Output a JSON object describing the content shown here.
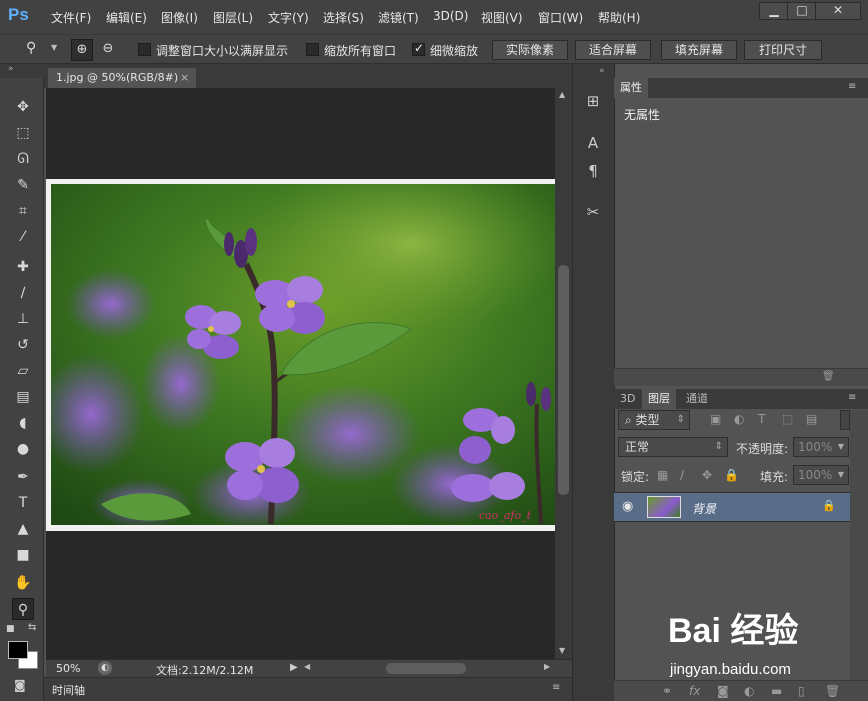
{
  "app": {
    "logo": "Ps"
  },
  "menu": [
    "文件(F)",
    "编辑(E)",
    "图像(I)",
    "图层(L)",
    "文字(Y)",
    "选择(S)",
    "滤镜(T)",
    "3D(D)",
    "视图(V)",
    "窗口(W)",
    "帮助(H)"
  ],
  "window_controls": [
    "▁",
    "□",
    "✕"
  ],
  "options": {
    "cb_resize_windows": "调整窗口大小以满屏显示",
    "cb_zoom_all": "缩放所有窗口",
    "cb_scrubby": "细微缩放",
    "scrubby_checked": true,
    "btn_actual": "实际像素",
    "btn_fit": "适合屏幕",
    "btn_fill": "填充屏幕",
    "btn_print": "打印尺寸"
  },
  "document": {
    "tab_title": "1.jpg @ 50%(RGB/8#)",
    "tab_close": "×",
    "zoom": "50%",
    "doc_info": "文档:2.12M/2.12M",
    "image_signature": "cao_afo_t"
  },
  "timeline": {
    "label": "时间轴"
  },
  "properties": {
    "tab": "属性",
    "content": "无属性"
  },
  "layers": {
    "tabs": [
      "3D",
      "图层",
      "通道"
    ],
    "active_tab": "图层",
    "filter_type": "类型",
    "blend_mode": "正常",
    "opacity_label": "不透明度:",
    "opacity_value": "100%",
    "lock_label": "锁定:",
    "fill_label": "填充:",
    "fill_value": "100%",
    "layer_name": "背景"
  },
  "watermark": {
    "brand": "Bai 经验",
    "url": "jingyan.baidu.com"
  },
  "colors": {
    "flower_purple": "#8a5bd0",
    "leaf_green": "#4c8a2e",
    "background_green": "#6a9a2a"
  }
}
